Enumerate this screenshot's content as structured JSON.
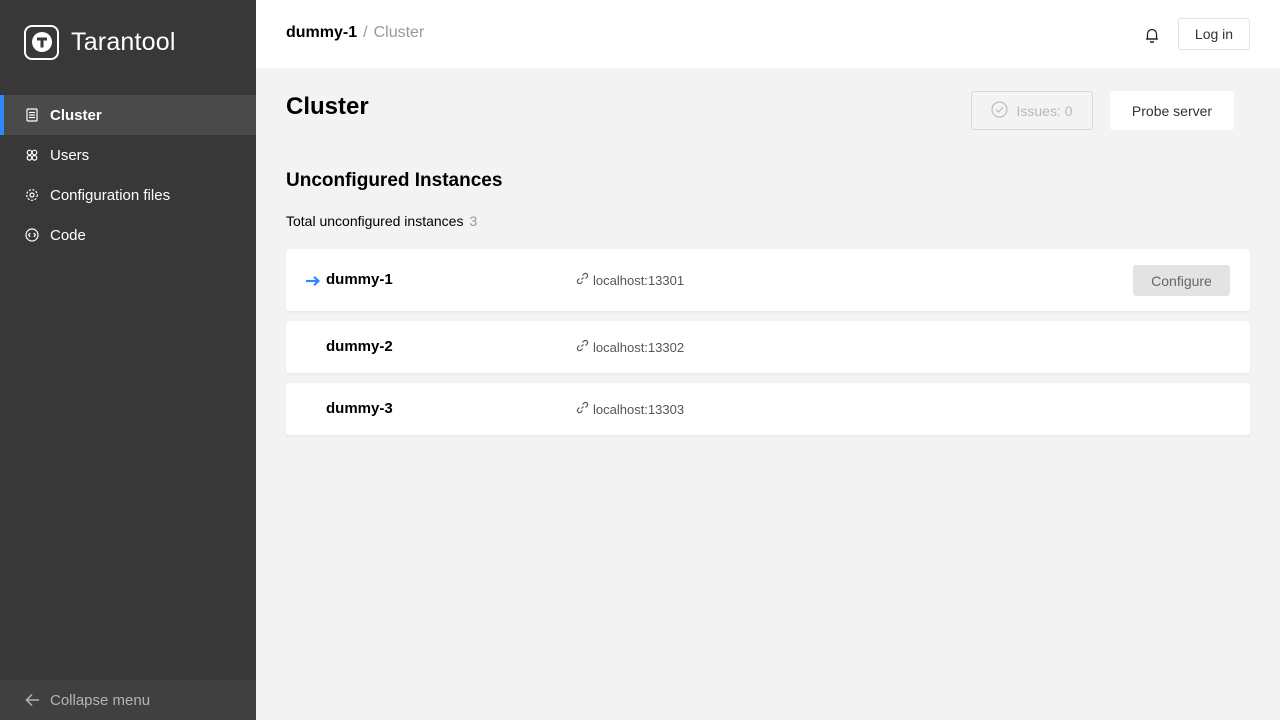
{
  "app": {
    "name": "Tarantool"
  },
  "sidebar": {
    "items": [
      {
        "label": "Cluster",
        "icon": "cluster-icon",
        "active": true
      },
      {
        "label": "Users",
        "icon": "users-icon",
        "active": false
      },
      {
        "label": "Configuration files",
        "icon": "gear-icon",
        "active": false
      },
      {
        "label": "Code",
        "icon": "code-icon",
        "active": false
      }
    ],
    "collapse_label": "Collapse menu"
  },
  "header": {
    "breadcrumb_current": "dummy-1",
    "breadcrumb_sep": "/",
    "breadcrumb_page": "Cluster",
    "login_label": "Log in"
  },
  "main": {
    "title": "Cluster",
    "issues_label": "Issues: 0",
    "probe_label": "Probe server",
    "section_title": "Unconfigured Instances",
    "total_label": "Total unconfigured instances",
    "total_count": "3",
    "instances": [
      {
        "name": "dummy-1",
        "uri": "localhost:13301",
        "current": true,
        "configure_label": "Configure"
      },
      {
        "name": "dummy-2",
        "uri": "localhost:13302",
        "current": false
      },
      {
        "name": "dummy-3",
        "uri": "localhost:13303",
        "current": false
      }
    ]
  },
  "colors": {
    "accent": "#2f88ff",
    "sidebar_bg": "#383838"
  }
}
